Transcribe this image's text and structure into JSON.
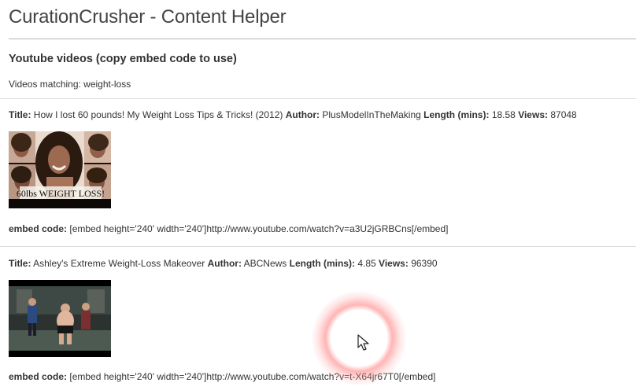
{
  "header": {
    "app_title": "CurationCrusher - Content Helper"
  },
  "section": {
    "heading": "Youtube videos (copy embed code to use)",
    "query_label": "Videos matching: weight-loss"
  },
  "labels": {
    "title": "Title:",
    "author": "Author:",
    "length": "Length (mins):",
    "views": "Views:",
    "embed_code": "embed code:"
  },
  "videos": [
    {
      "title": "How I lost 60 pounds! My Weight Loss Tips & Tricks! (2012)",
      "author": "PlusModelInTheMaking",
      "length": "18.58",
      "views": "87048",
      "thumbnail_caption": "60lbs WEIGHT LOSS!",
      "embed": "[embed height='240' width='240']http://www.youtube.com/watch?v=a3U2jGRBCns[/embed]"
    },
    {
      "title": "Ashley's Extreme Weight-Loss Makeover",
      "author": "ABCNews",
      "length": "4.85",
      "views": "96390",
      "embed": "[embed height='240' width='240']http://www.youtube.com/watch?v=t-X64jr67T0[/embed]"
    }
  ],
  "colors": {
    "text": "#333333",
    "title": "#444444",
    "rule": "#dddddd",
    "cursor_halo": "#ff7878"
  },
  "icons": {
    "cursor": "mouse-pointer-icon"
  }
}
